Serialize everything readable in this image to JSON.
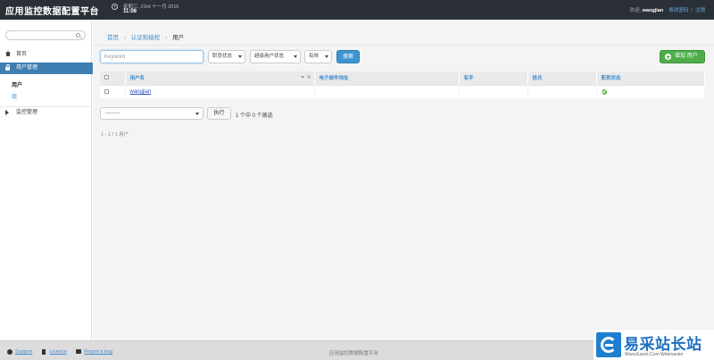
{
  "header": {
    "brand": "应用监控数据配置平台",
    "date": "星期三, 23rd 十一月 2016",
    "time": "11:08",
    "welcome": "欢迎,",
    "username": "wangjian",
    "change_password": "修改密码",
    "sep": "/",
    "logout": "注销"
  },
  "sidebar": {
    "home": "首页",
    "user_mgmt": "用户管理",
    "sub_users": "用户",
    "sub_groups": "组",
    "monitor_mgmt": "监控管理"
  },
  "breadcrumb": {
    "home": "首页",
    "auth": "认证和授权",
    "current": "用户",
    "sep": "›"
  },
  "filters": {
    "keyword_placeholder": "Keyword",
    "staff_status": "职员状态",
    "superuser_status": "超级用户状态",
    "active": "有效",
    "search_button": "搜索",
    "add_button": "增加 用户"
  },
  "table": {
    "columns": {
      "username": "用户名",
      "email": "电子邮件地址",
      "first_name": "名字",
      "last_name": "姓氏",
      "staff_status": "职员状态"
    },
    "sort_close": "✕",
    "rows": [
      {
        "username": "wangjian",
        "email": "",
        "first_name": "",
        "last_name": "",
        "staff_status": true
      }
    ]
  },
  "actions": {
    "select_value": "---------",
    "go_button": "执行",
    "selected_count": "1 个中 0 个被选"
  },
  "pagination": {
    "text": "1 - 1 / 1 用户"
  },
  "footer": {
    "support": "Support",
    "licence": "Licence",
    "report_bug": "Report a bug",
    "center": "应用监控数据配置平台"
  },
  "watermark": {
    "title": "易采站长站",
    "subtitle": "Www.Easck.Com Webmaster"
  },
  "colors": {
    "topbar": "#2b3038",
    "accent": "#3d7fb3",
    "link": "#3b8bd0",
    "success": "#4fae4a"
  }
}
